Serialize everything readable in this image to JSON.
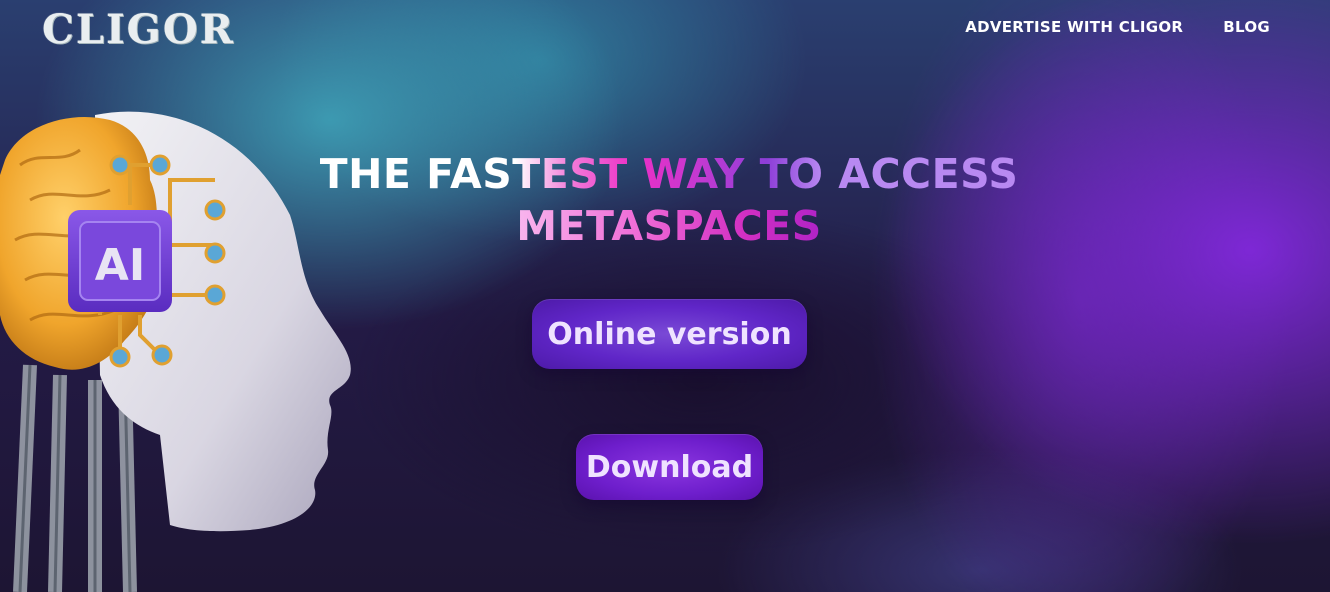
{
  "brand": {
    "logo_text": "CLIGOR"
  },
  "nav": {
    "items": [
      {
        "label": "ADVERTISE WITH CLIGOR"
      },
      {
        "label": "BLOG"
      }
    ]
  },
  "hero": {
    "title_line1": "THE FASTEST WAY TO ACCESS",
    "title_line2": "METASPACES",
    "primary_button": "Online version",
    "secondary_button": "Download",
    "illustration_badge": "AI"
  },
  "colors": {
    "accent_purple": "#6026c8",
    "accent_pink": "#ec2fc6",
    "teal": "#40aabe"
  }
}
